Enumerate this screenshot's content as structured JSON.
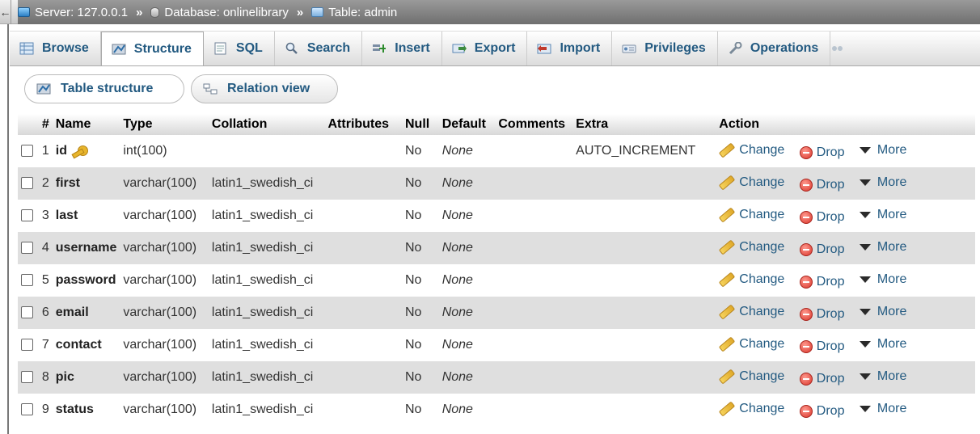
{
  "breadcrumb": {
    "back_glyph": "←",
    "server": "Server: 127.0.0.1",
    "database": "Database: onlinelibrary",
    "table": "Table: admin",
    "separator": "»"
  },
  "tabs": [
    {
      "label": "Browse",
      "icon": "browse-icon"
    },
    {
      "label": "Structure",
      "icon": "structure-icon",
      "active": true
    },
    {
      "label": "SQL",
      "icon": "sql-icon"
    },
    {
      "label": "Search",
      "icon": "search-icon"
    },
    {
      "label": "Insert",
      "icon": "insert-icon"
    },
    {
      "label": "Export",
      "icon": "export-icon"
    },
    {
      "label": "Import",
      "icon": "import-icon"
    },
    {
      "label": "Privileges",
      "icon": "privileges-icon"
    },
    {
      "label": "Operations",
      "icon": "operations-icon"
    }
  ],
  "subtabs": {
    "table_structure": "Table structure",
    "relation_view": "Relation view"
  },
  "columns": {
    "num": "#",
    "name": "Name",
    "type": "Type",
    "collation": "Collation",
    "attributes": "Attributes",
    "null": "Null",
    "default": "Default",
    "comments": "Comments",
    "extra": "Extra",
    "action": "Action"
  },
  "actions": {
    "change": "Change",
    "drop": "Drop",
    "more": "More"
  },
  "rows": [
    {
      "num": "1",
      "name": "id",
      "type": "int(100)",
      "collation": "",
      "null": "No",
      "default": "None",
      "extra": "AUTO_INCREMENT"
    },
    {
      "num": "2",
      "name": "first",
      "type": "varchar(100)",
      "collation": "latin1_swedish_ci",
      "null": "No",
      "default": "None",
      "extra": ""
    },
    {
      "num": "3",
      "name": "last",
      "type": "varchar(100)",
      "collation": "latin1_swedish_ci",
      "null": "No",
      "default": "None",
      "extra": ""
    },
    {
      "num": "4",
      "name": "username",
      "type": "varchar(100)",
      "collation": "latin1_swedish_ci",
      "null": "No",
      "default": "None",
      "extra": ""
    },
    {
      "num": "5",
      "name": "password",
      "type": "varchar(100)",
      "collation": "latin1_swedish_ci",
      "null": "No",
      "default": "None",
      "extra": ""
    },
    {
      "num": "6",
      "name": "email",
      "type": "varchar(100)",
      "collation": "latin1_swedish_ci",
      "null": "No",
      "default": "None",
      "extra": ""
    },
    {
      "num": "7",
      "name": "contact",
      "type": "varchar(100)",
      "collation": "latin1_swedish_ci",
      "null": "No",
      "default": "None",
      "extra": ""
    },
    {
      "num": "8",
      "name": "pic",
      "type": "varchar(100)",
      "collation": "latin1_swedish_ci",
      "null": "No",
      "default": "None",
      "extra": ""
    },
    {
      "num": "9",
      "name": "status",
      "type": "varchar(100)",
      "collation": "latin1_swedish_ci",
      "null": "No",
      "default": "None",
      "extra": ""
    }
  ],
  "colors": {
    "link": "#235a81",
    "row_alt": "#dfdfdf",
    "breadcrumb_bg": "#808080"
  }
}
